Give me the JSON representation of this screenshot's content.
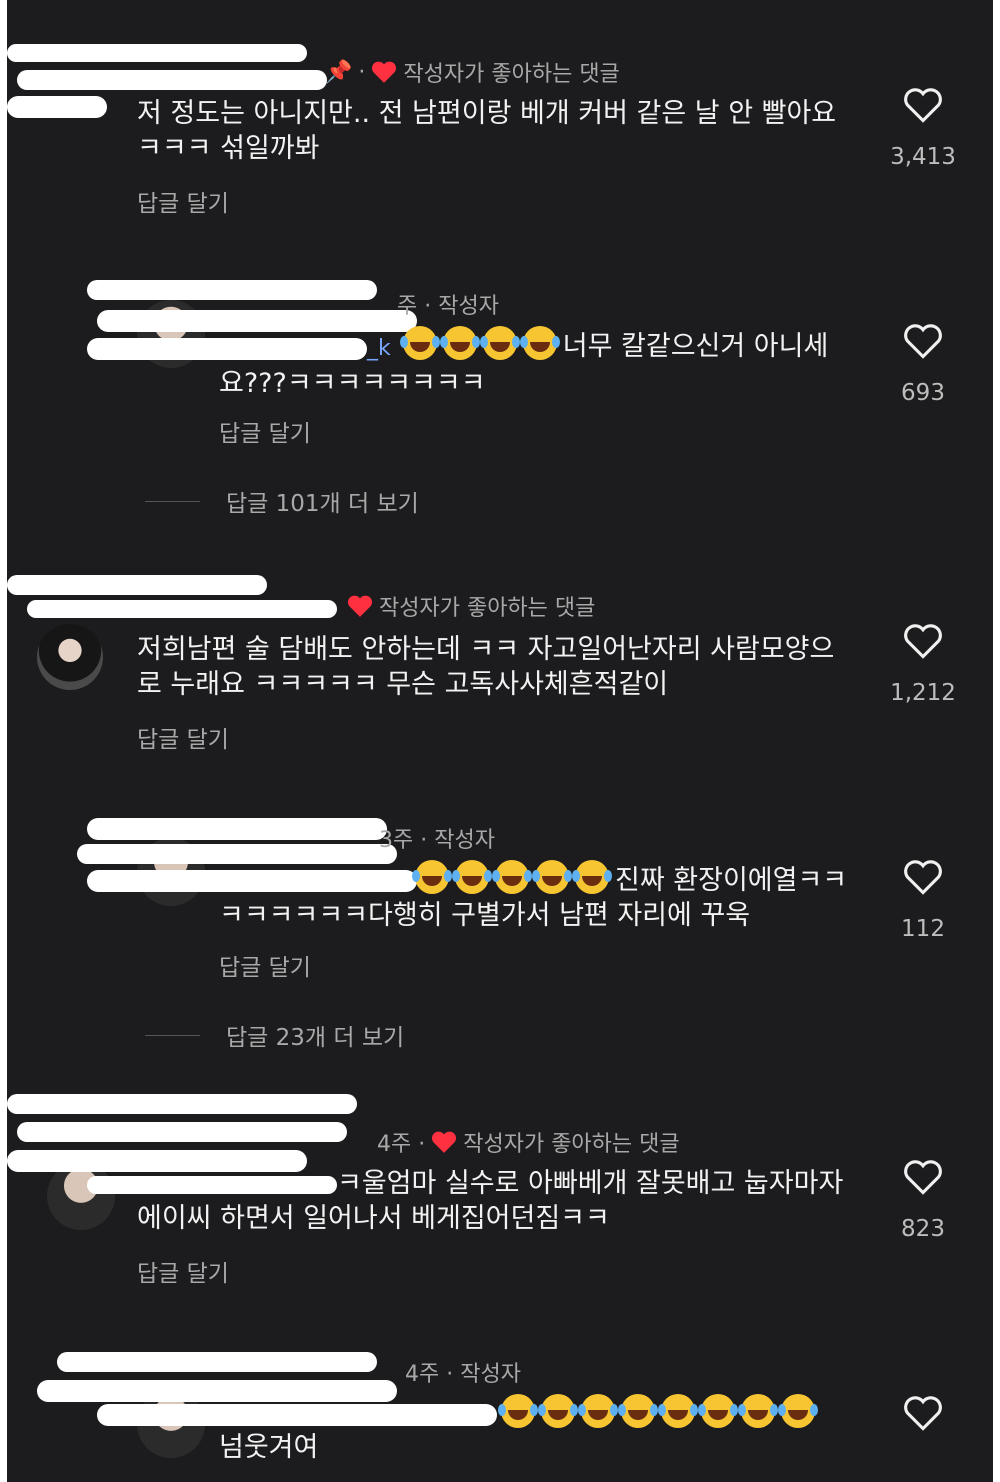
{
  "comments": [
    {
      "meta_suffix": "·",
      "meta_badge": "작성자가 좋아하는 댓글",
      "text": "저 정도는 아니지만.. 전 남편이랑 베개 커버 같은 날 안 빨아요 ㅋㅋㅋ 섞일까봐",
      "reply_label": "답글 달기",
      "likes": "3,413"
    },
    {
      "meta_suffix": "주 · 작성자",
      "user_fragment": "_k",
      "emoji_count": 4,
      "text": "너무 칼같으신거 아니세요???ㅋㅋㅋㅋㅋㅋㅋㅋ",
      "reply_label": "답글 달기",
      "more_replies": "답글 101개 더 보기",
      "likes": "693"
    },
    {
      "meta_badge": "작성자가 좋아하는 댓글",
      "text": "저희남편 술 담배도 안하는데 ㅋㅋ 자고일어난자리 사람모양으로 누래요 ㅋㅋㅋㅋㅋ  무슨 고독사사체흔적같이",
      "reply_label": "답글 달기",
      "likes": "1,212"
    },
    {
      "meta_suffix": "3주 · 작성자",
      "emoji_count": 5,
      "text": "진짜 환장이에열ㅋㅋㅋㅋㅋㅋㅋㅋ다행히 구별가서 남편 자리에 꾸욱",
      "reply_label": "답글 달기",
      "more_replies": "답글 23개 더 보기",
      "likes": "112"
    },
    {
      "meta_suffix": "4주 ·",
      "meta_badge": "작성자가 좋아하는 댓글",
      "text": "ㅋ울엄마 실수로 아빠베개 잘못배고 눕자마자 에이씨 하면서 일어나서 베게집어던짐ㅋㅋ",
      "reply_label": "답글 달기",
      "likes": "823"
    },
    {
      "meta_suffix": "4주 · 작성자",
      "emoji_count": 8,
      "text": "넘웃겨여",
      "likes": ""
    }
  ],
  "colors": {
    "background": "#1c1c1e",
    "like_heart": "#ff3040",
    "text_secondary": "#a8a8a8"
  },
  "icons": {
    "like": "heart-outline-icon",
    "liked_by_author": "heart-filled-icon",
    "pin": "pin-icon"
  }
}
